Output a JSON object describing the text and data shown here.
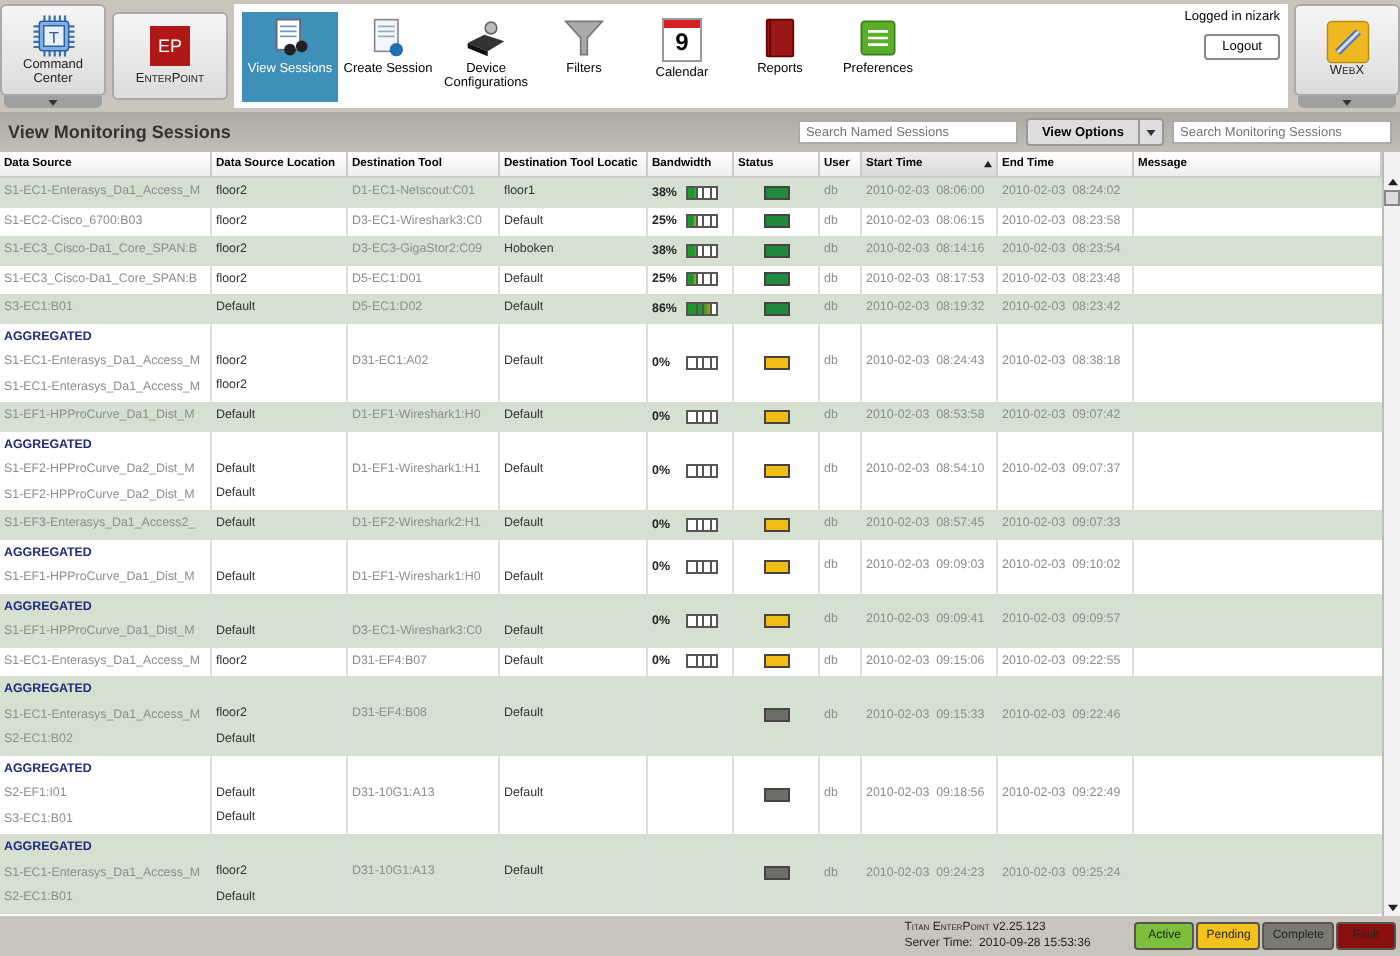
{
  "toolbar": {
    "command_center": {
      "logo_letter": "T",
      "label": "Command Center"
    },
    "enterpoint": {
      "logo_text": "EP",
      "label": "EnterPoint"
    },
    "items": [
      {
        "kind": "view",
        "label": "View Sessions",
        "selected": true
      },
      {
        "kind": "create",
        "label": "Create Session",
        "selected": false
      },
      {
        "kind": "device",
        "label": "Device Configurations",
        "selected": false
      },
      {
        "kind": "filter",
        "label": "Filters",
        "selected": false
      },
      {
        "kind": "calendar",
        "label": "Calendar",
        "selected": false,
        "day": "9"
      },
      {
        "kind": "reports",
        "label": "Reports",
        "selected": false
      },
      {
        "kind": "prefs",
        "label": "Preferences",
        "selected": false
      }
    ],
    "user": "Logged in nizark",
    "logout": "Logout",
    "webx": {
      "label": "WebX"
    }
  },
  "page_bar": {
    "title": "View Monitoring Sessions",
    "named_search": {
      "placeholder": "Search Named Sessions"
    },
    "view_options": "View Options",
    "monitor_search": {
      "placeholder": "Search Monitoring Sessions"
    }
  },
  "table": {
    "columns": [
      {
        "label": "Data Source",
        "sorted": false
      },
      {
        "label": "Data Source Location",
        "sorted": false
      },
      {
        "label": "Destination Tool",
        "sorted": false
      },
      {
        "label": "Destination Tool Locatic",
        "sorted": false
      },
      {
        "label": "Bandwidth",
        "sorted": false
      },
      {
        "label": "Status",
        "sorted": false
      },
      {
        "label": "User",
        "sorted": false
      },
      {
        "label": "Start Time",
        "sorted": true
      },
      {
        "label": "End Time",
        "sorted": false
      },
      {
        "label": "Message",
        "sorted": false
      }
    ],
    "rows": [
      {
        "aggregated": null,
        "sources": [
          {
            "name": "S1-EC1-Enterasys_Da1_Access_M",
            "location": "floor2"
          }
        ],
        "tool": "D1-EC1-Netscout:C01",
        "tool_location": "floor1",
        "bandwidth": {
          "text": "38%",
          "level": 0.38
        },
        "color": "#1f8a3c",
        "user": "db",
        "start": "2010-02-03  08:06:00",
        "end": "2010-02-03  08:24:02"
      },
      {
        "aggregated": null,
        "sources": [
          {
            "name": "S1-EC2-Cisco_6700:B03",
            "location": "floor2"
          }
        ],
        "tool": "D3-EC1-Wireshark3:C0",
        "tool_location": "Default",
        "bandwidth": {
          "text": "25%",
          "level": 0.25
        },
        "color": "#1f8a3c",
        "user": "db",
        "start": "2010-02-03  08:06:15",
        "end": "2010-02-03  08:23:58"
      },
      {
        "aggregated": null,
        "sources": [
          {
            "name": "S1-EC3_Cisco-Da1_Core_SPAN:B",
            "location": "floor2"
          }
        ],
        "tool": "D3-EC3-GigaStor2:C09",
        "tool_location": "Hoboken",
        "bandwidth": {
          "text": "38%",
          "level": 0.38
        },
        "color": "#1f8a3c",
        "user": "db",
        "start": "2010-02-03  08:14:16",
        "end": "2010-02-03  08:23:54"
      },
      {
        "aggregated": null,
        "sources": [
          {
            "name": "S1-EC3_Cisco-Da1_Core_SPAN:B",
            "location": "floor2"
          }
        ],
        "tool": "D5-EC1:D01",
        "tool_location": "Default",
        "bandwidth": {
          "text": "25%",
          "level": 0.25
        },
        "color": "#1f8a3c",
        "user": "db",
        "start": "2010-02-03  08:17:53",
        "end": "2010-02-03  08:23:48"
      },
      {
        "aggregated": null,
        "sources": [
          {
            "name": "S3-EC1:B01",
            "location": "Default"
          }
        ],
        "tool": "D5-EC1:D02",
        "tool_location": "Default",
        "bandwidth": {
          "text": "86%",
          "level": 0.86
        },
        "color": "#1f8a3c",
        "user": "db",
        "start": "2010-02-03  08:19:32",
        "end": "2010-02-03  08:23:42"
      },
      {
        "aggregated": "AGGREGATED",
        "sources": [
          {
            "name": "S1-EC1-Enterasys_Da1_Access_M",
            "location": "floor2"
          },
          {
            "name": "S1-EC1-Enterasys_Da1_Access_M",
            "location": "floor2"
          }
        ],
        "tool": "D31-EC1:A02",
        "tool_location": "Default",
        "bandwidth": {
          "text": "0%",
          "level": 0
        },
        "color": "#f2bd12",
        "user": "db",
        "start": "2010-02-03  08:24:43",
        "end": "2010-02-03  08:38:18"
      },
      {
        "aggregated": null,
        "sources": [
          {
            "name": "S1-EF1-HPProCurve_Da1_Dist_M",
            "location": "Default"
          }
        ],
        "tool": "D1-EF1-Wireshark1:H0",
        "tool_location": "Default",
        "bandwidth": {
          "text": "0%",
          "level": 0
        },
        "color": "#f2bd12",
        "user": "db",
        "start": "2010-02-03  08:53:58",
        "end": "2010-02-03  09:07:42"
      },
      {
        "aggregated": "AGGREGATED",
        "sources": [
          {
            "name": "S1-EF2-HPProCurve_Da2_Dist_M",
            "location": "Default"
          },
          {
            "name": "S1-EF2-HPProCurve_Da2_Dist_M",
            "location": "Default"
          }
        ],
        "tool": "D1-EF1-Wireshark1:H1",
        "tool_location": "Default",
        "bandwidth": {
          "text": "0%",
          "level": 0
        },
        "color": "#f2bd12",
        "user": "db",
        "start": "2010-02-03  08:54:10",
        "end": "2010-02-03  09:07:37"
      },
      {
        "aggregated": null,
        "sources": [
          {
            "name": "S1-EF3-Enterasys_Da1_Access2_",
            "location": "Default"
          }
        ],
        "tool": "D1-EF2-Wireshark2:H1",
        "tool_location": "Default",
        "bandwidth": {
          "text": "0%",
          "level": 0
        },
        "color": "#f2bd12",
        "user": "db",
        "start": "2010-02-03  08:57:45",
        "end": "2010-02-03  09:07:33"
      },
      {
        "aggregated": "AGGREGATED",
        "sources": [
          {
            "name": "S1-EF1-HPProCurve_Da1_Dist_M",
            "location": "Default"
          }
        ],
        "tool": "D1-EF1-Wireshark1:H0",
        "tool_location": "Default",
        "bandwidth": {
          "text": "0%",
          "level": 0
        },
        "color": "#f2bd12",
        "user": "db",
        "start": "2010-02-03  09:09:03",
        "end": "2010-02-03  09:10:02"
      },
      {
        "aggregated": "AGGREGATED",
        "sources": [
          {
            "name": "S1-EF1-HPProCurve_Da1_Dist_M",
            "location": "Default"
          }
        ],
        "tool": "D3-EC1-Wireshark3:C0",
        "tool_location": "Default",
        "bandwidth": {
          "text": "0%",
          "level": 0
        },
        "color": "#f2bd12",
        "user": "db",
        "start": "2010-02-03  09:09:41",
        "end": "2010-02-03  09:09:57"
      },
      {
        "aggregated": null,
        "sources": [
          {
            "name": "S1-EC1-Enterasys_Da1_Access_M",
            "location": "floor2"
          }
        ],
        "tool": "D31-EF4:B07",
        "tool_location": "Default",
        "bandwidth": {
          "text": "0%",
          "level": 0
        },
        "color": "#f2bd12",
        "user": "db",
        "start": "2010-02-03  09:15:06",
        "end": "2010-02-03  09:22:55"
      },
      {
        "aggregated": "AGGREGATED",
        "sources": [
          {
            "name": "S1-EC1-Enterasys_Da1_Access_M",
            "location": "floor2"
          },
          {
            "name": "S2-EC1:B02",
            "location": "Default"
          }
        ],
        "tool": "D31-EF4:B08",
        "tool_location": "Default",
        "bandwidth": null,
        "color": "#6e6e68",
        "user": "db",
        "start": "2010-02-03  09:15:33",
        "end": "2010-02-03  09:22:46"
      },
      {
        "aggregated": "AGGREGATED",
        "sources": [
          {
            "name": "S2-EF1:I01",
            "location": "Default"
          },
          {
            "name": "S3-EC1:B01",
            "location": "Default"
          }
        ],
        "tool": "D31-10G1:A13",
        "tool_location": "Default",
        "bandwidth": null,
        "color": "#6e6e68",
        "user": "db",
        "start": "2010-02-03  09:18:56",
        "end": "2010-02-03  09:22:49"
      },
      {
        "aggregated": "AGGREGATED",
        "sources": [
          {
            "name": "S1-EC1-Enterasys_Da1_Access_M",
            "location": "floor2"
          },
          {
            "name": "S2-EC1:B01",
            "location": "Default"
          }
        ],
        "tool": "D31-10G1:A13",
        "tool_location": "Default",
        "bandwidth": null,
        "color": "#6e6e68",
        "user": "db",
        "start": "2010-02-03  09:24:23",
        "end": "2010-02-03  09:25:24"
      }
    ]
  },
  "status_bar": {
    "product": "Titan EnterPoint",
    "version": "v2.25.123",
    "server_time_label": "Server Time:",
    "server_time": "2010-09-28 15:53:36",
    "legend": [
      {
        "label": "Active",
        "color": "#7cbf3a"
      },
      {
        "label": "Pending",
        "color": "#f2c21b"
      },
      {
        "label": "Complete",
        "color": "#7a7a72"
      },
      {
        "label": "Fault",
        "color": "#8a1010"
      }
    ]
  }
}
